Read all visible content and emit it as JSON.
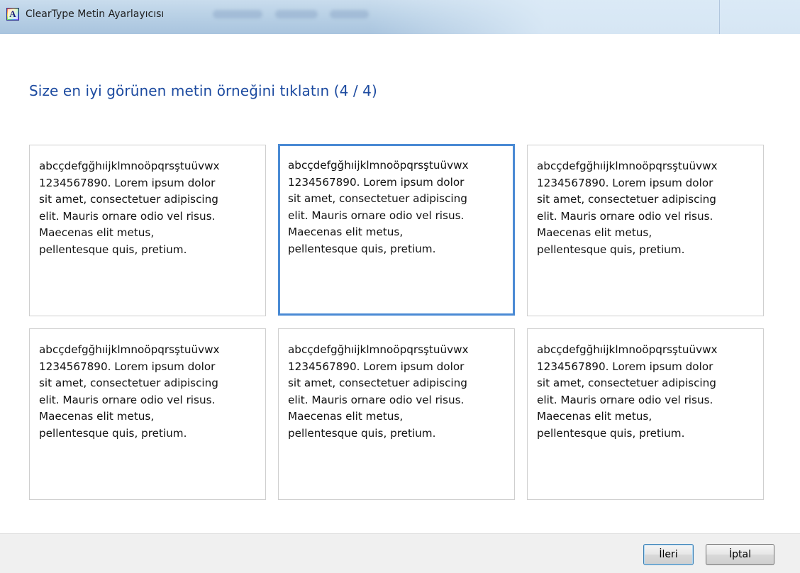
{
  "window": {
    "title": "ClearType Metin Ayarlayıcısı",
    "app_icon_letter": "A"
  },
  "heading": "Size en iyi görünen metin örneğini tıklatın (4 / 4)",
  "samples": [
    {
      "text": "abcçdefgğhıijklmnoöpqrsştuüvwx\n1234567890. Lorem ipsum dolor\nsit amet, consectetuer adipiscing\nelit. Mauris ornare odio vel risus.\nMaecenas elit metus,\npellentesque quis, pretium.",
      "selected": false
    },
    {
      "text": "abcçdefgğhıijklmnoöpqrsştuüvwx\n1234567890. Lorem ipsum dolor\nsit amet, consectetuer adipiscing\nelit. Mauris ornare odio vel risus.\nMaecenas elit metus,\npellentesque quis, pretium.",
      "selected": true
    },
    {
      "text": "abcçdefgğhıijklmnoöpqrsştuüvwx\n1234567890. Lorem ipsum dolor\nsit amet, consectetuer adipiscing\nelit. Mauris ornare odio vel risus.\nMaecenas elit metus,\npellentesque quis, pretium.",
      "selected": false
    },
    {
      "text": "abcçdefgğhıijklmnoöpqrsştuüvwx\n1234567890. Lorem ipsum dolor\nsit amet, consectetuer adipiscing\nelit. Mauris ornare odio vel risus.\nMaecenas elit metus,\npellentesque quis, pretium.",
      "selected": false
    },
    {
      "text": "abcçdefgğhıijklmnoöpqrsştuüvwx\n1234567890. Lorem ipsum dolor\nsit amet, consectetuer adipiscing\nelit. Mauris ornare odio vel risus.\nMaecenas elit metus,\npellentesque quis, pretium.",
      "selected": false
    },
    {
      "text": "abcçdefgğhıijklmnoöpqrsştuüvwx\n1234567890. Lorem ipsum dolor\nsit amet, consectetuer adipiscing\nelit. Mauris ornare odio vel risus.\nMaecenas elit metus,\npellentesque quis, pretium.",
      "selected": false
    }
  ],
  "buttons": {
    "next_label": "İleri",
    "cancel_label": "İptal"
  },
  "colors": {
    "heading": "#1d4ba0",
    "selection_border": "#4a8ad4"
  }
}
